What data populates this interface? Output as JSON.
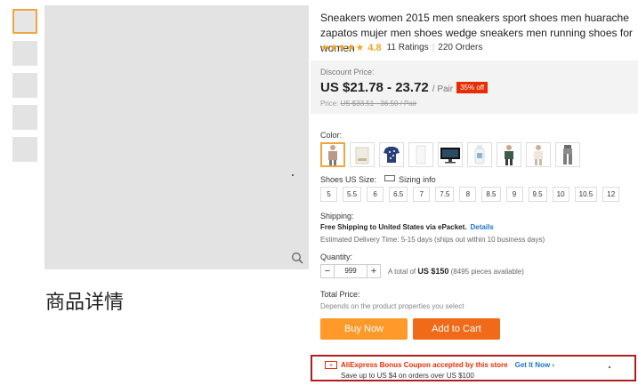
{
  "gallery": {
    "thumbnail_count": 5,
    "detail_heading": "商品详情"
  },
  "product": {
    "title": "Sneakers women 2015 men sneakers sport shoes men huarache zapatos mujer men shoes wedge sneakers men running shoes for women",
    "stars": "★★★★★",
    "rating": "4.8",
    "ratings_count": "11 Ratings",
    "separator": "|",
    "orders": "220 Orders"
  },
  "price": {
    "discount_label": "Discount Price:",
    "value": "US $21.78 - 23.72",
    "unit": "/ Pair",
    "off_badge": "35% off",
    "original_label": "Price:",
    "original_value": "US $33.51 - 36.50 / Pair"
  },
  "color": {
    "label": "Color:",
    "swatch_icons": [
      "man-shirt-icon",
      "shoe-box-icon",
      "patterned-shirt-icon",
      "white-item-icon",
      "monitor-icon",
      "bottle-icon",
      "man-jacket-icon",
      "man-pants-icon",
      "man-jeans-icon"
    ]
  },
  "size": {
    "label": "Shoes US Size:",
    "info_link": "Sizing info",
    "options": [
      "5",
      "5.5",
      "6",
      "6.5",
      "7",
      "7.5",
      "8",
      "8.5",
      "9",
      "9.5",
      "10",
      "10.5",
      "12"
    ]
  },
  "shipping": {
    "label": "Shipping:",
    "free_text": "Free Shipping to United States via ePacket.",
    "details_link": "Details",
    "estimate": "Estimated Delivery Time: 5-15 days (ships out within 10 business days)"
  },
  "quantity": {
    "label": "Quantity:",
    "minus": "−",
    "value": "999",
    "plus": "+",
    "total_prefix": "A total of",
    "total_value": "US $150",
    "available": "(8495 pieces available)"
  },
  "total_price": {
    "label": "Total Price:",
    "hint": "Depends on the product properties you select"
  },
  "buttons": {
    "buy_now": "Buy Now",
    "add_to_cart": "Add to Cart"
  },
  "coupon": {
    "icon_text": "+",
    "title": "AliExpress Bonus Coupon accepted by this store",
    "link": "Get It Now ›",
    "subtitle": "Save up to US $4 on orders over US $100"
  },
  "colors": {
    "accent_orange": "#ff9a2a",
    "cart_orange": "#f06a19",
    "sale_red": "#e62e04",
    "link_blue": "#1e75c9",
    "star_gold": "#f5a623",
    "coupon_border": "#b11e22"
  }
}
